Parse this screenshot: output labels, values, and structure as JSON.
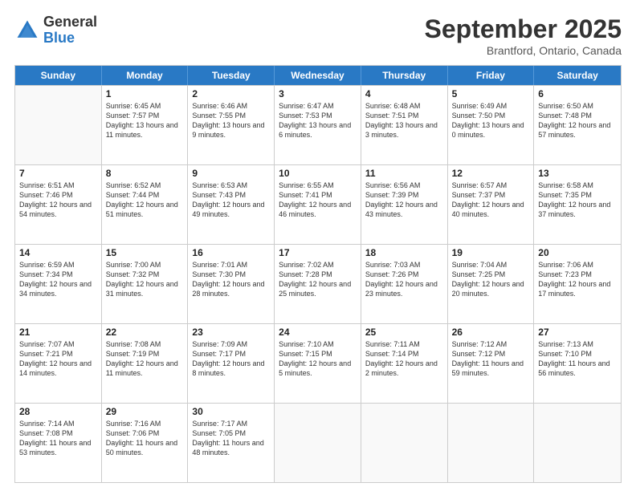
{
  "logo": {
    "general": "General",
    "blue": "Blue"
  },
  "header": {
    "month": "September 2025",
    "location": "Brantford, Ontario, Canada"
  },
  "days": [
    "Sunday",
    "Monday",
    "Tuesday",
    "Wednesday",
    "Thursday",
    "Friday",
    "Saturday"
  ],
  "weeks": [
    [
      {
        "date": "",
        "sunrise": "",
        "sunset": "",
        "daylight": ""
      },
      {
        "date": "1",
        "sunrise": "Sunrise: 6:45 AM",
        "sunset": "Sunset: 7:57 PM",
        "daylight": "Daylight: 13 hours and 11 minutes."
      },
      {
        "date": "2",
        "sunrise": "Sunrise: 6:46 AM",
        "sunset": "Sunset: 7:55 PM",
        "daylight": "Daylight: 13 hours and 9 minutes."
      },
      {
        "date": "3",
        "sunrise": "Sunrise: 6:47 AM",
        "sunset": "Sunset: 7:53 PM",
        "daylight": "Daylight: 13 hours and 6 minutes."
      },
      {
        "date": "4",
        "sunrise": "Sunrise: 6:48 AM",
        "sunset": "Sunset: 7:51 PM",
        "daylight": "Daylight: 13 hours and 3 minutes."
      },
      {
        "date": "5",
        "sunrise": "Sunrise: 6:49 AM",
        "sunset": "Sunset: 7:50 PM",
        "daylight": "Daylight: 13 hours and 0 minutes."
      },
      {
        "date": "6",
        "sunrise": "Sunrise: 6:50 AM",
        "sunset": "Sunset: 7:48 PM",
        "daylight": "Daylight: 12 hours and 57 minutes."
      }
    ],
    [
      {
        "date": "7",
        "sunrise": "Sunrise: 6:51 AM",
        "sunset": "Sunset: 7:46 PM",
        "daylight": "Daylight: 12 hours and 54 minutes."
      },
      {
        "date": "8",
        "sunrise": "Sunrise: 6:52 AM",
        "sunset": "Sunset: 7:44 PM",
        "daylight": "Daylight: 12 hours and 51 minutes."
      },
      {
        "date": "9",
        "sunrise": "Sunrise: 6:53 AM",
        "sunset": "Sunset: 7:43 PM",
        "daylight": "Daylight: 12 hours and 49 minutes."
      },
      {
        "date": "10",
        "sunrise": "Sunrise: 6:55 AM",
        "sunset": "Sunset: 7:41 PM",
        "daylight": "Daylight: 12 hours and 46 minutes."
      },
      {
        "date": "11",
        "sunrise": "Sunrise: 6:56 AM",
        "sunset": "Sunset: 7:39 PM",
        "daylight": "Daylight: 12 hours and 43 minutes."
      },
      {
        "date": "12",
        "sunrise": "Sunrise: 6:57 AM",
        "sunset": "Sunset: 7:37 PM",
        "daylight": "Daylight: 12 hours and 40 minutes."
      },
      {
        "date": "13",
        "sunrise": "Sunrise: 6:58 AM",
        "sunset": "Sunset: 7:35 PM",
        "daylight": "Daylight: 12 hours and 37 minutes."
      }
    ],
    [
      {
        "date": "14",
        "sunrise": "Sunrise: 6:59 AM",
        "sunset": "Sunset: 7:34 PM",
        "daylight": "Daylight: 12 hours and 34 minutes."
      },
      {
        "date": "15",
        "sunrise": "Sunrise: 7:00 AM",
        "sunset": "Sunset: 7:32 PM",
        "daylight": "Daylight: 12 hours and 31 minutes."
      },
      {
        "date": "16",
        "sunrise": "Sunrise: 7:01 AM",
        "sunset": "Sunset: 7:30 PM",
        "daylight": "Daylight: 12 hours and 28 minutes."
      },
      {
        "date": "17",
        "sunrise": "Sunrise: 7:02 AM",
        "sunset": "Sunset: 7:28 PM",
        "daylight": "Daylight: 12 hours and 25 minutes."
      },
      {
        "date": "18",
        "sunrise": "Sunrise: 7:03 AM",
        "sunset": "Sunset: 7:26 PM",
        "daylight": "Daylight: 12 hours and 23 minutes."
      },
      {
        "date": "19",
        "sunrise": "Sunrise: 7:04 AM",
        "sunset": "Sunset: 7:25 PM",
        "daylight": "Daylight: 12 hours and 20 minutes."
      },
      {
        "date": "20",
        "sunrise": "Sunrise: 7:06 AM",
        "sunset": "Sunset: 7:23 PM",
        "daylight": "Daylight: 12 hours and 17 minutes."
      }
    ],
    [
      {
        "date": "21",
        "sunrise": "Sunrise: 7:07 AM",
        "sunset": "Sunset: 7:21 PM",
        "daylight": "Daylight: 12 hours and 14 minutes."
      },
      {
        "date": "22",
        "sunrise": "Sunrise: 7:08 AM",
        "sunset": "Sunset: 7:19 PM",
        "daylight": "Daylight: 12 hours and 11 minutes."
      },
      {
        "date": "23",
        "sunrise": "Sunrise: 7:09 AM",
        "sunset": "Sunset: 7:17 PM",
        "daylight": "Daylight: 12 hours and 8 minutes."
      },
      {
        "date": "24",
        "sunrise": "Sunrise: 7:10 AM",
        "sunset": "Sunset: 7:15 PM",
        "daylight": "Daylight: 12 hours and 5 minutes."
      },
      {
        "date": "25",
        "sunrise": "Sunrise: 7:11 AM",
        "sunset": "Sunset: 7:14 PM",
        "daylight": "Daylight: 12 hours and 2 minutes."
      },
      {
        "date": "26",
        "sunrise": "Sunrise: 7:12 AM",
        "sunset": "Sunset: 7:12 PM",
        "daylight": "Daylight: 11 hours and 59 minutes."
      },
      {
        "date": "27",
        "sunrise": "Sunrise: 7:13 AM",
        "sunset": "Sunset: 7:10 PM",
        "daylight": "Daylight: 11 hours and 56 minutes."
      }
    ],
    [
      {
        "date": "28",
        "sunrise": "Sunrise: 7:14 AM",
        "sunset": "Sunset: 7:08 PM",
        "daylight": "Daylight: 11 hours and 53 minutes."
      },
      {
        "date": "29",
        "sunrise": "Sunrise: 7:16 AM",
        "sunset": "Sunset: 7:06 PM",
        "daylight": "Daylight: 11 hours and 50 minutes."
      },
      {
        "date": "30",
        "sunrise": "Sunrise: 7:17 AM",
        "sunset": "Sunset: 7:05 PM",
        "daylight": "Daylight: 11 hours and 48 minutes."
      },
      {
        "date": "",
        "sunrise": "",
        "sunset": "",
        "daylight": ""
      },
      {
        "date": "",
        "sunrise": "",
        "sunset": "",
        "daylight": ""
      },
      {
        "date": "",
        "sunrise": "",
        "sunset": "",
        "daylight": ""
      },
      {
        "date": "",
        "sunrise": "",
        "sunset": "",
        "daylight": ""
      }
    ]
  ]
}
